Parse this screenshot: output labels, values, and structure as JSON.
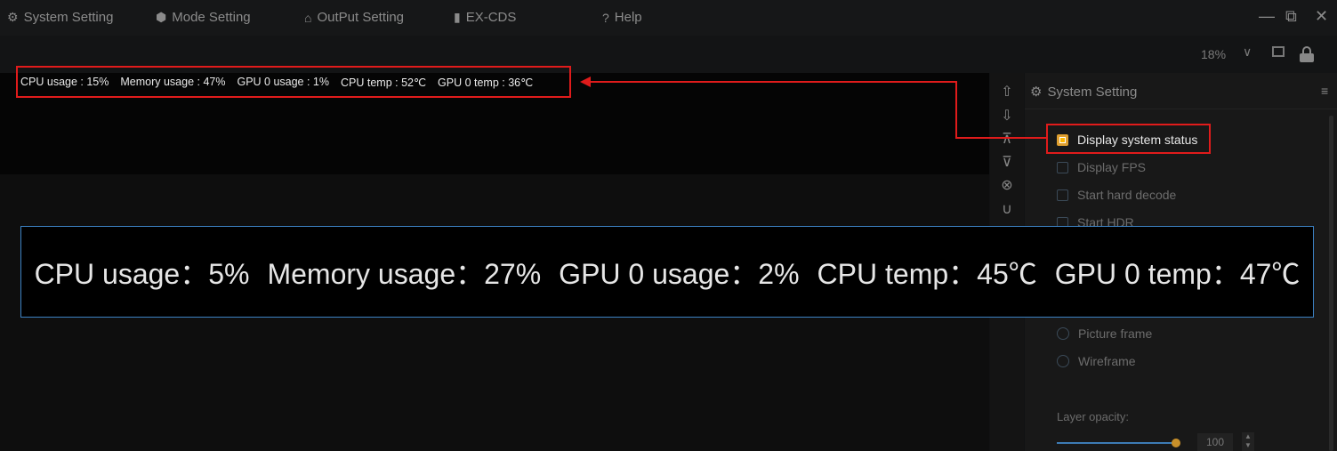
{
  "menu": {
    "system_setting": "System Setting",
    "mode_setting": "Mode Setting",
    "output_setting": "OutPut Setting",
    "ex_cds": "EX-CDS",
    "help": "Help"
  },
  "window_controls": [
    "—",
    "⧉",
    "✕"
  ],
  "zoom": "18%",
  "status_small": {
    "cpu": "CPU usage : 15%",
    "memory": "Memory usage : 47%",
    "gpu_usage": "GPU 0 usage : 1%",
    "cpu_temp": "CPU temp : 52℃",
    "gpu_temp": "GPU 0 temp : 36℃"
  },
  "panel": {
    "title": "System Setting",
    "options": {
      "display_system_status": "Display system status",
      "display_fps": "Display FPS",
      "start_hard_decode": "Start hard decode",
      "start_hdr": "Start HDR",
      "picture_frame": "Picture frame",
      "wireframe": "Wireframe"
    },
    "layer_opacity_label": "Layer opacity:",
    "layer_opacity_value": "100"
  },
  "status_large": {
    "cpu": "CPU usage：5%",
    "memory": "Memory usage：27%",
    "gpu_usage": "GPU 0 usage：2%",
    "cpu_temp": "CPU temp：45℃",
    "gpu_temp": "GPU 0 temp：47℃"
  },
  "colors": {
    "highlight": "#e01b1b",
    "checkbox_checked": "#ffb700",
    "zoom_box_border": "#3c82c4"
  }
}
